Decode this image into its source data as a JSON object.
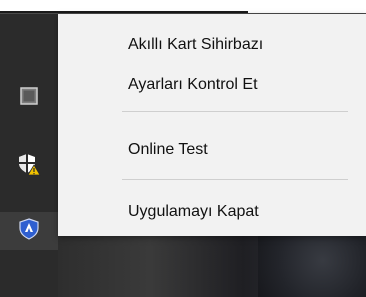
{
  "menu": {
    "items": [
      {
        "label": "Akıllı Kart Sihirbazı"
      },
      {
        "label": "Ayarları Kontrol Et"
      },
      {
        "label": "Online Test"
      },
      {
        "label": "Uygulamayı Kapat"
      }
    ]
  },
  "tray": {
    "icons": [
      "grid-app-icon",
      "security-warning-shield-icon",
      "smart-card-shield-icon"
    ]
  },
  "colors": {
    "menu_bg": "#f2f2f2",
    "taskbar_bg": "#2b2b2b",
    "shield_blue": "#2f5fd0",
    "warning_yellow": "#f2c200"
  }
}
